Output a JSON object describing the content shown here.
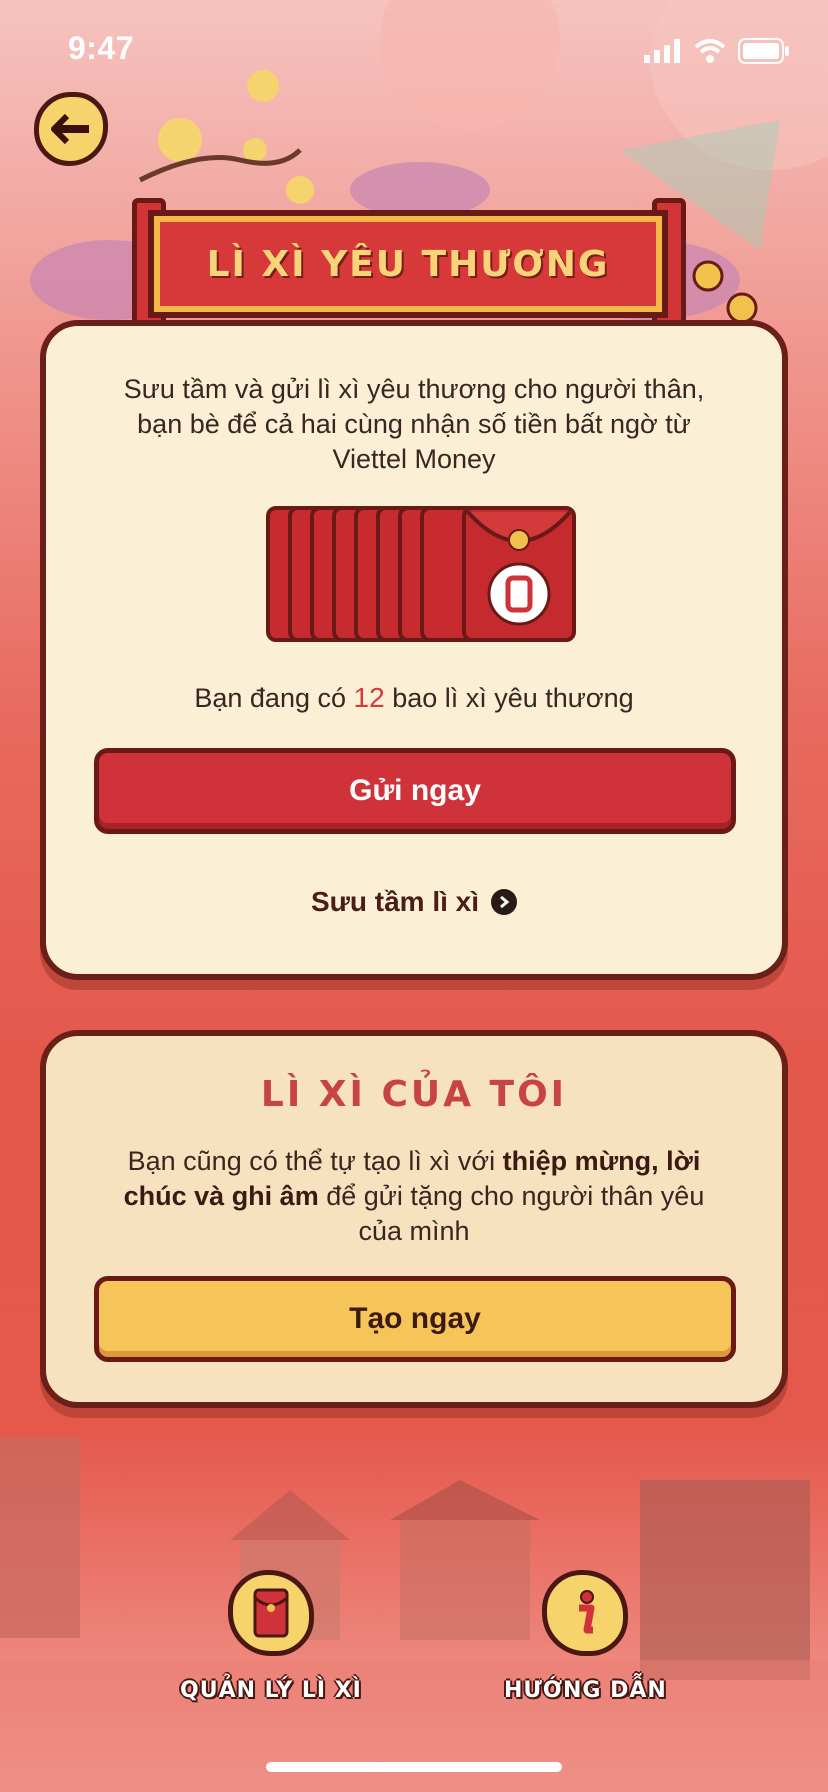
{
  "status_bar": {
    "time": "9:47"
  },
  "header": {
    "title": "LÌ XÌ YÊU THƯƠNG"
  },
  "main_card": {
    "intro": "Sưu tầm và gửi lì xì yêu thương cho người thân, bạn bè để cả hai cùng nhận số tiền bất ngờ từ Viettel Money",
    "count_prefix": "Bạn đang có",
    "count_value": "12",
    "count_suffix": "bao lì xì yêu thương",
    "send_label": "Gửi ngay",
    "collect_label": "Sưu tầm lì xì"
  },
  "my_card": {
    "title": "LÌ XÌ CỦA TÔI",
    "text_part1": "Bạn cũng có thể tự tạo lì xì với",
    "text_bold": "thiệp mừng, lời chúc và ghi âm",
    "text_part2": "để gửi tặng cho người thân yêu của mình",
    "create_label": "Tạo ngay"
  },
  "bottom_nav": {
    "manage_label": "QUẢN LÝ LÌ XÌ",
    "guide_label": "HƯỚNG DẪN"
  },
  "colors": {
    "primary_red": "#d0323a",
    "gold": "#f6c55a",
    "dark_brown": "#6a1a16",
    "cream": "#fbefd6"
  },
  "icons": [
    "back-arrow-icon",
    "red-envelope-icon",
    "phone-logo-icon",
    "chevron-right-icon",
    "info-icon",
    "signal-icon",
    "wifi-icon",
    "battery-icon"
  ]
}
